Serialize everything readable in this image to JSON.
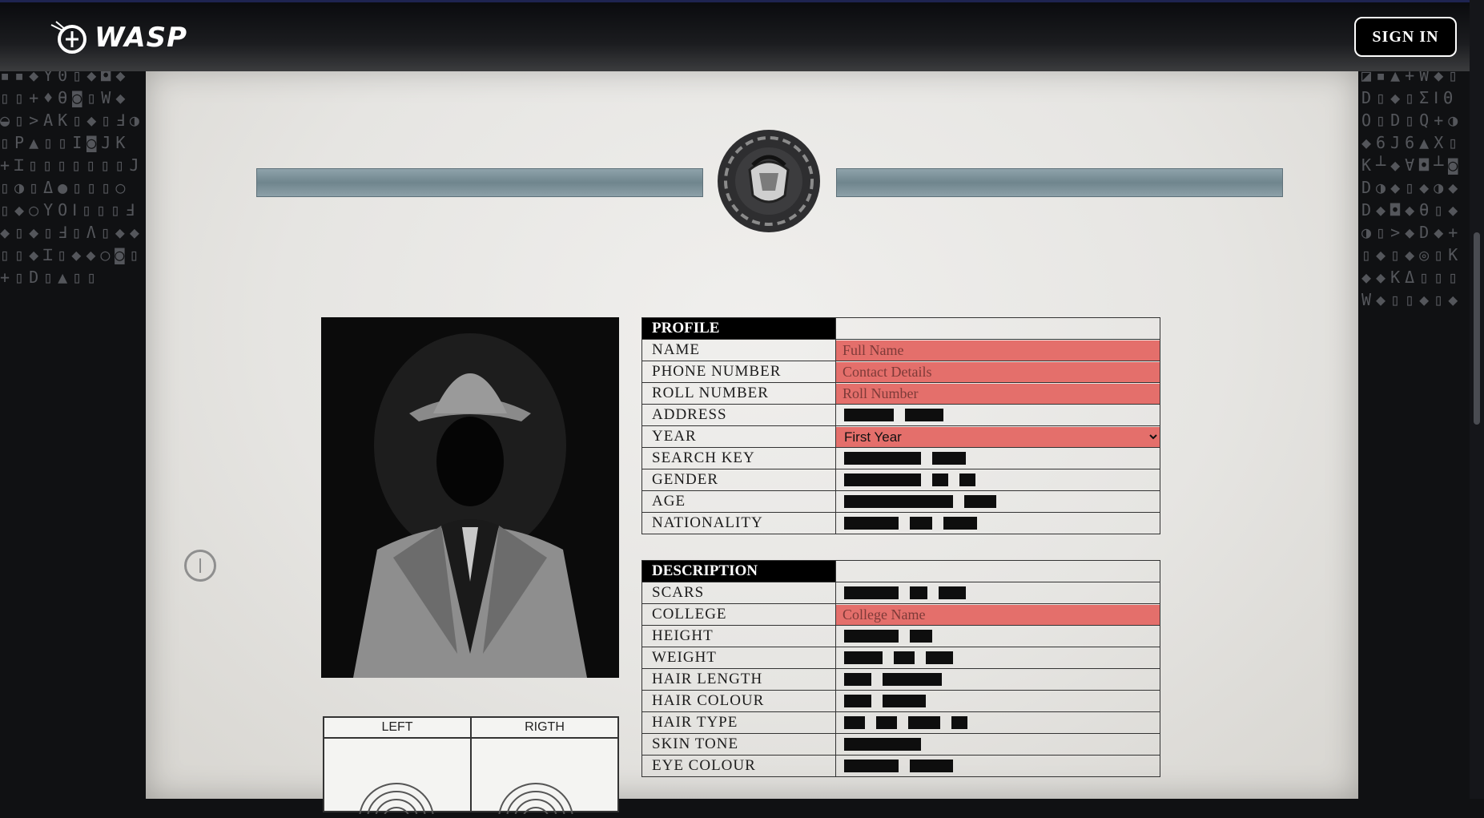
{
  "header": {
    "logo_text": "WASP",
    "sign_in_label": "SIGN IN"
  },
  "side_glyphs": {
    "left": "▪▪◆Y0▯◆◘◆▯▯+♦Ѳ◙▯W◆◒▯>AK▯◆▯Ⅎ◑▯P▲▯▯I◙JK+Ɪ▯▯▯▯▯▯▯J▯◑▯Δ●▯▯▯○▯◆○ΥОⅠ▯▯▯Ⅎ◆▯◆▯Ⅎ▯Ʌ▯◆◆▯▯◆Ɪ▯◆◆○◙▯+▯D▯▲▯▯",
    "right": "◪▪▲+W◆▯D▯◆▯ΣⅠΘΟ▯D▯Q+◑◆6J6▲X▯K┴◆Ɐ◘┴◙D◑◆▯◆◑◆D◆◘◆Ѳ▯◆◑▯>◆D◆+▯◆▯◆◎▯K◆◆KΔ▯▯▯W◆▯▯◆▯◆"
  },
  "document": {
    "fingerprints": {
      "left_label": "LEFT",
      "right_label": "RIGTH"
    },
    "profile": {
      "header": "PROFILE",
      "name_label": "NAME",
      "name_placeholder": "Full Name",
      "phone_label": "PHONE NUMBER",
      "phone_placeholder": "Contact Details",
      "roll_label": "ROLL NUMBER",
      "roll_placeholder": "Roll Number",
      "address_label": "ADDRESS",
      "year_label": "YEAR",
      "year_selected": "First Year",
      "search_key_label": "SEARCH KEY",
      "gender_label": "GENDER",
      "age_label": "AGE",
      "nationality_label": "NATIONALITY"
    },
    "description": {
      "header": "DESCRIPTION",
      "scars_label": "SCARS",
      "college_label": "COLLEGE",
      "college_placeholder": "College Name",
      "height_label": "HEIGHT",
      "weight_label": "WEIGHT",
      "hair_length_label": "HAIR LENGTH",
      "hair_colour_label": "HAIR COLOUR",
      "hair_type_label": "HAIR TYPE",
      "skin_tone_label": "SKIN TONE",
      "eye_colour_label": "EYE COLOUR"
    }
  },
  "colors": {
    "field_red": "#e46f6b",
    "paper": "#e6e5e2",
    "band": "#7b9098"
  }
}
